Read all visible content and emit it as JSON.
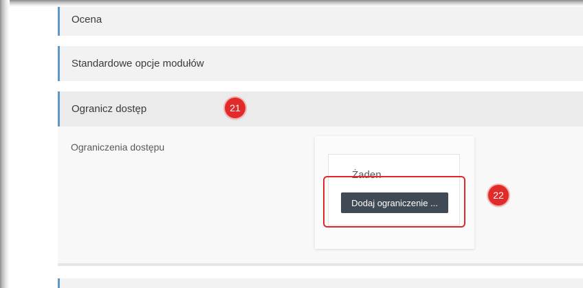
{
  "sections": {
    "ocena": "Ocena",
    "standard_options": "Standardowe opcje modułów",
    "restrict_access": "Ogranicz dostęp"
  },
  "restrictions": {
    "label": "Ograniczenia dostępu",
    "none_text": "Żaden",
    "add_button": "Dodaj ograniczenie ..."
  },
  "annotations": {
    "step_21": "21",
    "step_22": "22"
  },
  "colors": {
    "accent_border": "#5f97c8",
    "button_bg": "#3f4a55",
    "annotation_red": "#e12b2b"
  }
}
